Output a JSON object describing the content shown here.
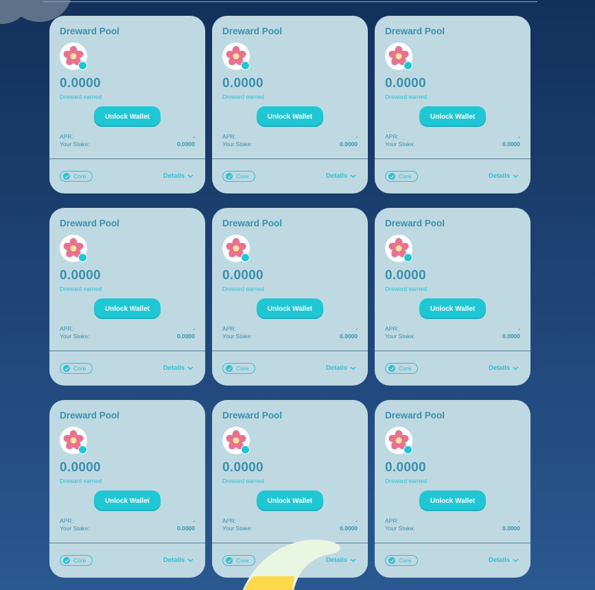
{
  "colors": {
    "background_top": "#13305b",
    "background_bottom": "#2a5890",
    "card": "#bfd9e2",
    "accent": "#1fc7d4",
    "title_text": "#3b8fae",
    "divider": "#5a7f95",
    "flower_petal": "#e8718f",
    "moon": "#fdd94b"
  },
  "decor": {
    "cloud_icon": "cloud-icon",
    "moon_icon": "crescent-moon-icon"
  },
  "pools": [
    {
      "title": "Dreward Pool",
      "token_icon": "flower-token-icon",
      "earned_value": "0.0000",
      "earned_label": "Dreward earned",
      "unlock_label": "Unlock Wallet",
      "apr_label": "APR:",
      "apr_value": "-",
      "stake_label": "Your Stake:",
      "stake_value": "0.0000",
      "tag_label": "Core",
      "details_label": "Details"
    },
    {
      "title": "Dreward Pool",
      "token_icon": "flower-token-icon",
      "earned_value": "0.0000",
      "earned_label": "Dreward earned",
      "unlock_label": "Unlock Wallet",
      "apr_label": "APR:",
      "apr_value": "-",
      "stake_label": "Your Stake:",
      "stake_value": "0.0000",
      "tag_label": "Core",
      "details_label": "Details"
    },
    {
      "title": "Dreward Pool",
      "token_icon": "flower-token-icon",
      "earned_value": "0.0000",
      "earned_label": "Dreward earned",
      "unlock_label": "Unlock Wallet",
      "apr_label": "APR:",
      "apr_value": "-",
      "stake_label": "Your Stake:",
      "stake_value": "0.0000",
      "tag_label": "Core",
      "details_label": "Details"
    },
    {
      "title": "Dreward Pool",
      "token_icon": "flower-token-icon",
      "earned_value": "0.0000",
      "earned_label": "Dreward earned",
      "unlock_label": "Unlock Wallet",
      "apr_label": "APR:",
      "apr_value": "-",
      "stake_label": "Your Stake:",
      "stake_value": "0.0000",
      "tag_label": "Core",
      "details_label": "Details"
    },
    {
      "title": "Dreward Pool",
      "token_icon": "flower-token-icon",
      "earned_value": "0.0000",
      "earned_label": "Dreward earned",
      "unlock_label": "Unlock Wallet",
      "apr_label": "APR:",
      "apr_value": "-",
      "stake_label": "Your Stake:",
      "stake_value": "0.0000",
      "tag_label": "Core",
      "details_label": "Details"
    },
    {
      "title": "Dreward Pool",
      "token_icon": "flower-token-icon",
      "earned_value": "0.0000",
      "earned_label": "Dreward earned",
      "unlock_label": "Unlock Wallet",
      "apr_label": "APR:",
      "apr_value": "-",
      "stake_label": "Your Stake:",
      "stake_value": "0.0000",
      "tag_label": "Core",
      "details_label": "Details"
    },
    {
      "title": "Dreward Pool",
      "token_icon": "flower-token-icon",
      "earned_value": "0.0000",
      "earned_label": "Dreward earned",
      "unlock_label": "Unlock Wallet",
      "apr_label": "APR:",
      "apr_value": "-",
      "stake_label": "Your Stake:",
      "stake_value": "0.0000",
      "tag_label": "Core",
      "details_label": "Details"
    },
    {
      "title": "Dreward Pool",
      "token_icon": "flower-token-icon",
      "earned_value": "0.0000",
      "earned_label": "Dreward earned",
      "unlock_label": "Unlock Wallet",
      "apr_label": "APR:",
      "apr_value": "-",
      "stake_label": "Your Stake:",
      "stake_value": "0.0000",
      "tag_label": "Core",
      "details_label": "Details"
    },
    {
      "title": "Dreward Pool",
      "token_icon": "flower-token-icon",
      "earned_value": "0.0000",
      "earned_label": "Dreward earned",
      "unlock_label": "Unlock Wallet",
      "apr_label": "APR:",
      "apr_value": "-",
      "stake_label": "Your Stake:",
      "stake_value": "0.0000",
      "tag_label": "Core",
      "details_label": "Details"
    }
  ]
}
